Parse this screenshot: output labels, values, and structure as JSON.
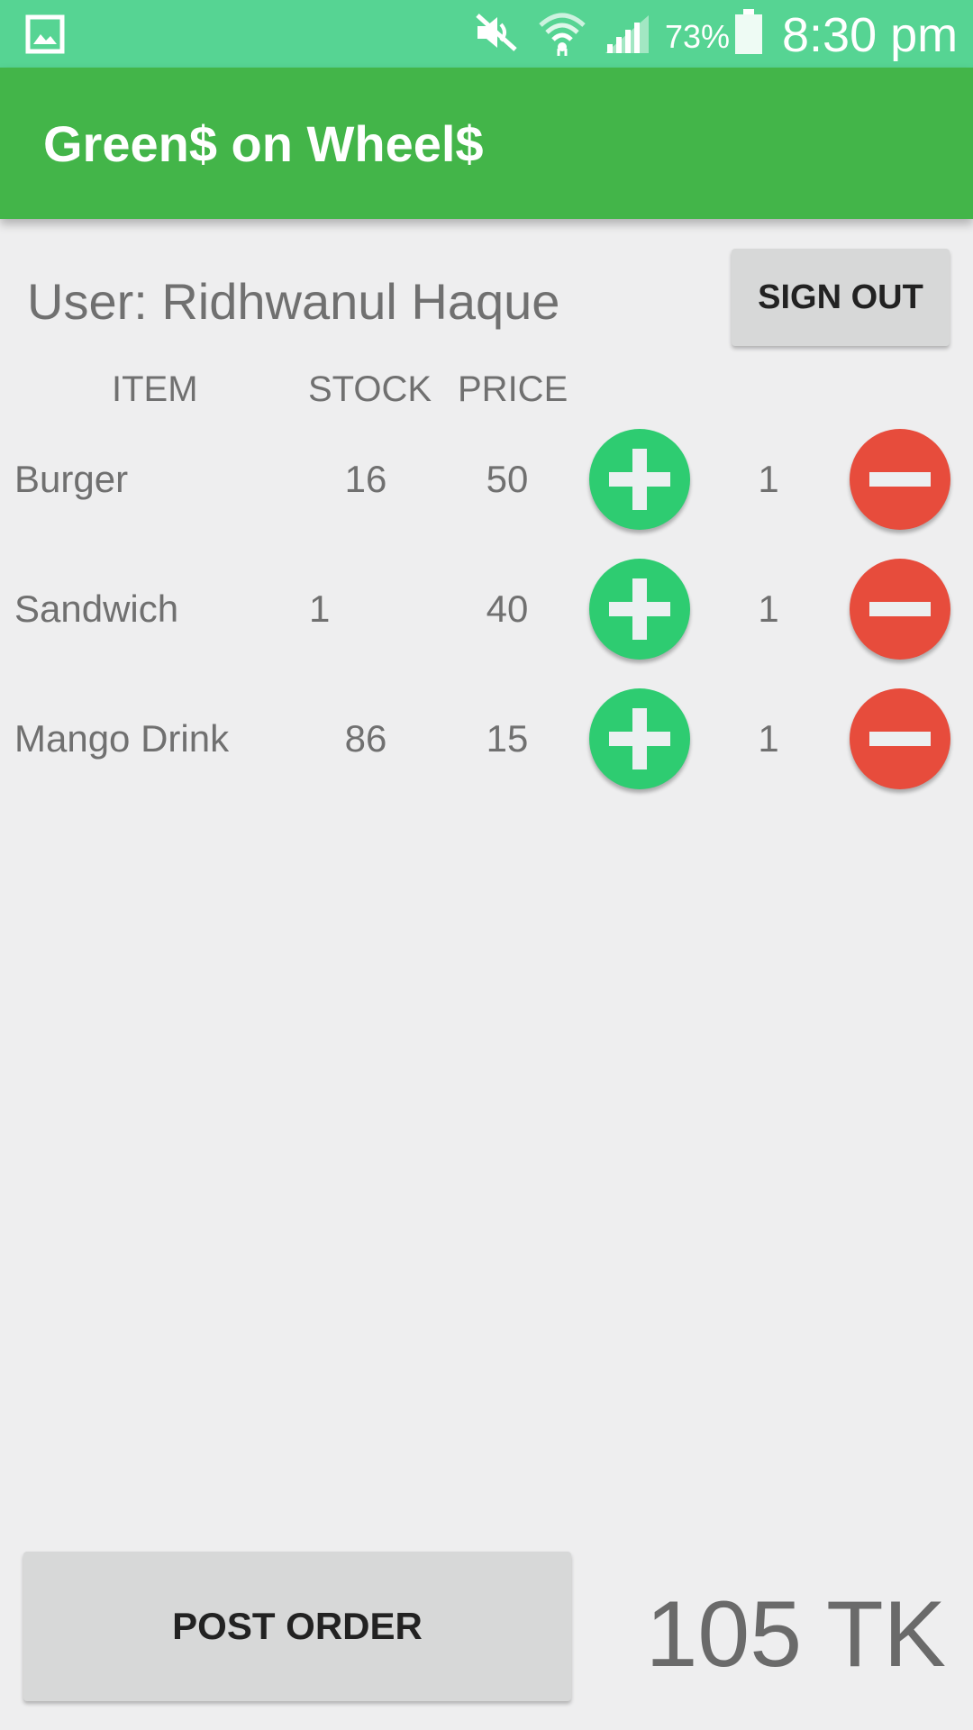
{
  "status_bar": {
    "battery_percent": "73%",
    "time": "8:30 pm",
    "icons": [
      "gallery-icon",
      "mute-icon",
      "wifi-icon",
      "signal-icon",
      "battery-icon"
    ]
  },
  "app_bar": {
    "title": "Green$ on Wheel$"
  },
  "user": {
    "label": "User: Ridhwanul Haque"
  },
  "sign_out_label": "SIGN OUT",
  "table": {
    "headers": {
      "item": "ITEM",
      "stock": "STOCK",
      "price": "PRICE"
    },
    "rows": [
      {
        "item": "Burger",
        "stock": "16",
        "price": "50",
        "qty": "1"
      },
      {
        "item": "Sandwich",
        "stock": "1",
        "price": "40",
        "qty": "1"
      },
      {
        "item": "Mango Drink",
        "stock": "86",
        "price": "15",
        "qty": "1"
      }
    ]
  },
  "post_order_label": "POST ORDER",
  "total": "105 TK",
  "colors": {
    "status_bar": "#56d493",
    "app_bar": "#43b549",
    "add_button": "#2ecc71",
    "remove_button": "#e74c3c"
  }
}
